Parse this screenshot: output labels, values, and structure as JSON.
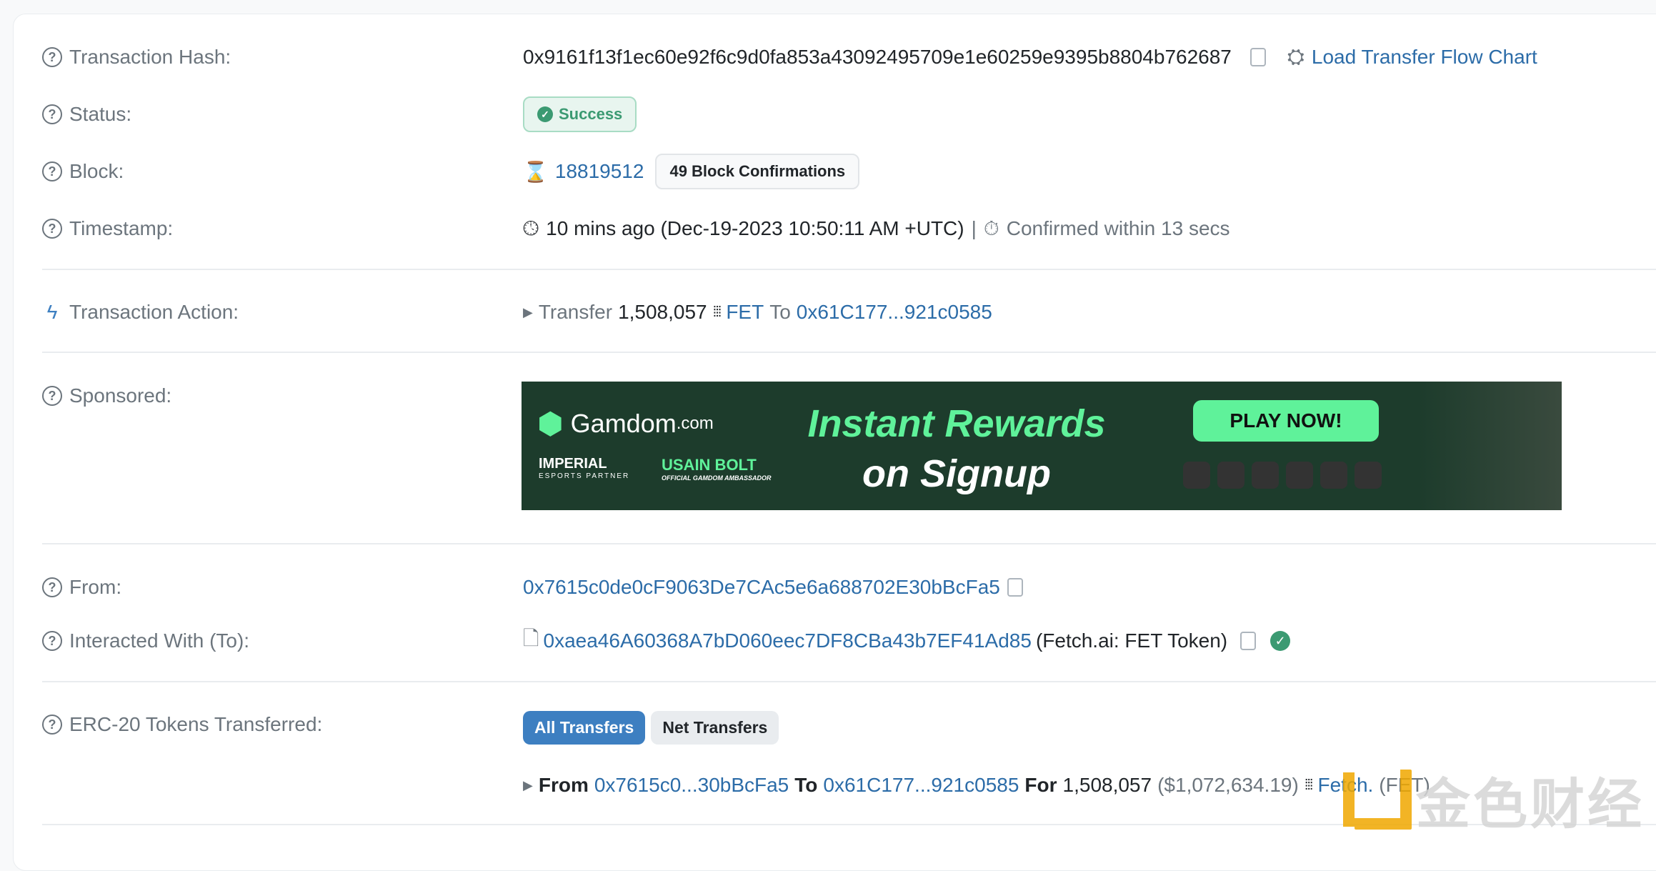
{
  "rows": {
    "hash": {
      "label": "Transaction Hash:",
      "value": "0x9161f13f1ec60e92f6c9d0fa853a43092495709e1e60259e9395b8804b762687",
      "flow_link": "Load Transfer Flow Chart"
    },
    "status": {
      "label": "Status:",
      "value": "Success"
    },
    "block": {
      "label": "Block:",
      "value": "18819512",
      "confirmations": "49 Block Confirmations"
    },
    "timestamp": {
      "label": "Timestamp:",
      "value": "10 mins ago (Dec-19-2023 10:50:11 AM +UTC)",
      "sep": "|",
      "confirmed": "Confirmed within 13 secs"
    },
    "action": {
      "label": "Transaction Action:",
      "verb": "Transfer",
      "amount": "1,508,057",
      "token": "FET",
      "to_word": "To",
      "to": "0x61C177...921c0585"
    },
    "sponsored": {
      "label": "Sponsored:"
    },
    "from": {
      "label": "From:",
      "value": "0x7615c0de0cF9063De7CAc5e6a688702E30bBcFa5"
    },
    "to": {
      "label": "Interacted With (To):",
      "value": "0xaea46A60368A7bD060eec7DF8CBa43b7EF41Ad85",
      "name": "(Fetch.ai: FET Token)"
    },
    "erc20": {
      "label": "ERC-20 Tokens Transferred:",
      "tabs": [
        "All Transfers",
        "Net Transfers"
      ],
      "transfer": {
        "from_word": "From",
        "from": "0x7615c0...30bBcFa5",
        "to_word": "To",
        "to": "0x61C177...921c0585",
        "for_word": "For",
        "amount": "1,508,057",
        "usd": "($1,072,634.19)",
        "token": "Fetch.",
        "symbol": "(FET)"
      }
    }
  },
  "banner": {
    "brand": "Gamdom",
    "brand_suffix": ".com",
    "headline1": "Instant Rewards",
    "headline2": "on Signup",
    "cta": "PLAY NOW!",
    "partner1": "IMPERIAL",
    "partner1_sub": "ESPORTS PARTNER",
    "partner2": "USAIN BOLT",
    "partner2_sub": "OFFICIAL GAMDOM AMBASSADOR"
  },
  "watermark": "金色财经",
  "colors": {
    "link": "#2c6ca8",
    "success": "#3b9a72",
    "primary": "#3d7fc1",
    "banner_bg": "#1d3c2c",
    "cta": "#5ff29a"
  }
}
